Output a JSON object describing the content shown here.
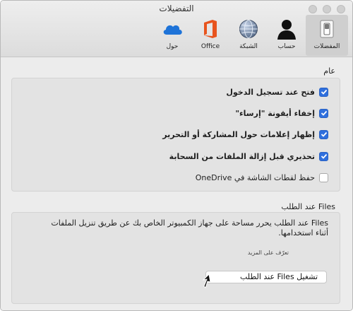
{
  "window": {
    "title": "التفضيلات"
  },
  "toolbar": {
    "items": [
      {
        "label": "المفضلات",
        "icon": "switch-icon",
        "active": true
      },
      {
        "label": "حساب",
        "icon": "person-icon",
        "active": false
      },
      {
        "label": "الشبكة",
        "icon": "globe-icon",
        "active": false
      },
      {
        "label": "Office",
        "icon": "office-icon",
        "active": false
      },
      {
        "label": "حول",
        "icon": "onedrive-cloud-icon",
        "active": false
      }
    ]
  },
  "general": {
    "title": "عام",
    "options": [
      {
        "label": "فتح عند تسجيل الدخول",
        "checked": true
      },
      {
        "label": "إخفاء أيقونة \"إرساء\"",
        "checked": true
      },
      {
        "label": "إظهار إعلامات حول المشاركة أو التحرير",
        "checked": true
      },
      {
        "label": "تحذيري قبل إزالة الملفات من السحابة",
        "checked": true
      },
      {
        "label": "حفظ لقطات الشاشة في OneDrive",
        "checked": false
      }
    ]
  },
  "files_on_demand": {
    "title": "Files عند الطلب",
    "description_line1": "Files عند الطلب يحرر مساحة على جهاز الكمبيوتر الخاص بك عن طريق تنزيل الملفات",
    "description_line2": "أثناء استخدامها.",
    "learn_more": "تعرّف على المزيد",
    "button": "تشغيل Files عند الطلب"
  },
  "colors": {
    "checkbox_accent": "#2f6fdd",
    "office_orange": "#e8541e",
    "onedrive_blue": "#1e73d8"
  }
}
